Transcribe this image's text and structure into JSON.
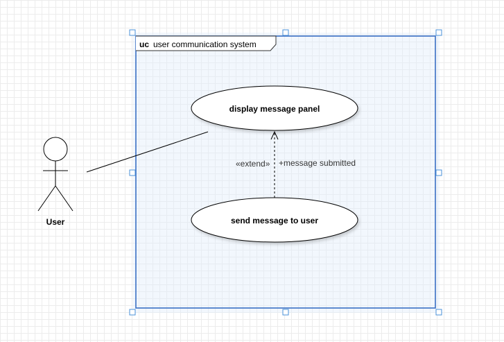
{
  "diagram": {
    "frame": {
      "keyword": "uc",
      "title": "user communication system"
    },
    "actor": {
      "label": "User"
    },
    "use_cases": {
      "display": "display message panel",
      "send": "send message to user"
    },
    "relationship": {
      "stereotype": "«extend»",
      "condition": "+message submitted"
    }
  },
  "colors": {
    "selection": "#3a6fc4",
    "handle": "#4a90d9",
    "stroke": "#000000",
    "canvas_grid": "#ececec"
  }
}
